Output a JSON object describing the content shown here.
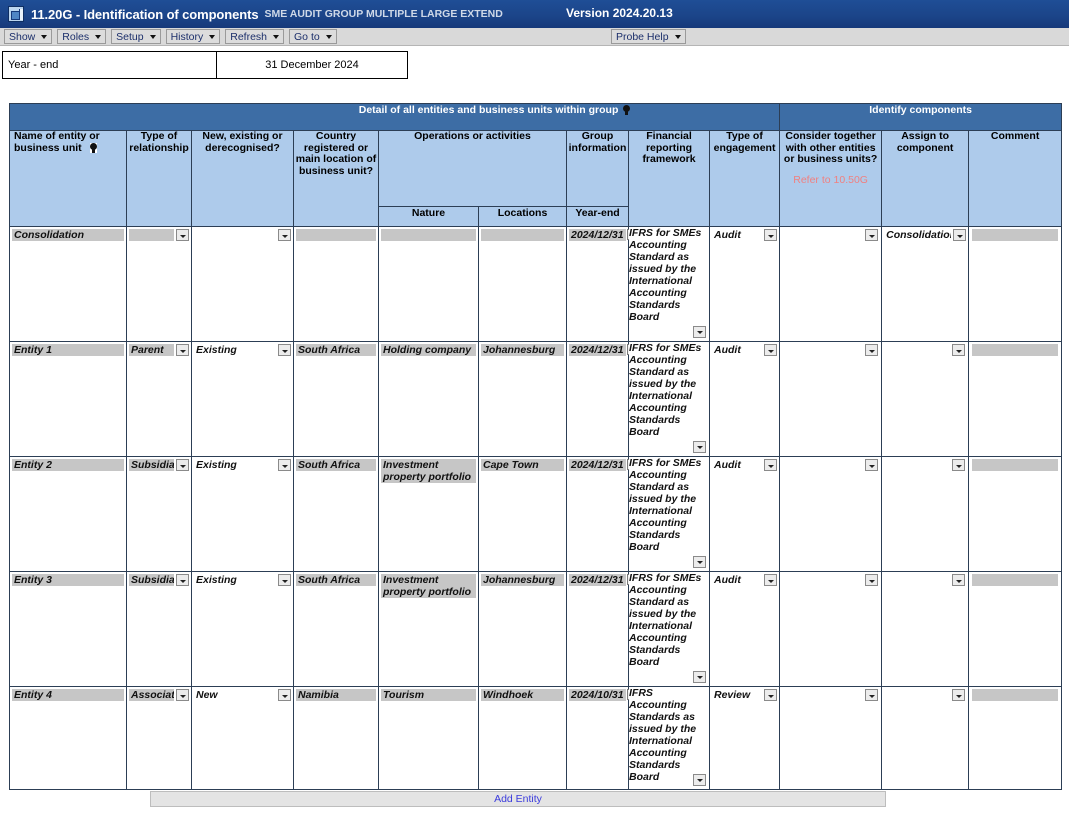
{
  "titlebar": {
    "icon": "app-window-icon",
    "title": "11.20G - Identification of components",
    "subtitle": "SME  AUDIT  GROUP MULTIPLE  LARGE  EXTEND",
    "version": "Version 2024.20.13"
  },
  "menubar": {
    "items": [
      {
        "label": "Show"
      },
      {
        "label": "Roles"
      },
      {
        "label": "Setup"
      },
      {
        "label": "History"
      },
      {
        "label": "Refresh"
      },
      {
        "label": "Go to"
      }
    ],
    "probe_help": "Probe Help"
  },
  "infostrip": {
    "label": "Year - end",
    "value": "31 December 2024"
  },
  "grid": {
    "bands": {
      "detail": "Detail of all entities and business units within group",
      "identify": "Identify components"
    },
    "headers": {
      "name": "Name of entity or business unit",
      "type_of_relationship": "Type of relationship",
      "new_existing": "New, existing or derecognised?",
      "country": "Country registered or main location of business unit?",
      "operations": "Operations or activities",
      "nature": "Nature",
      "locations": "Locations",
      "group_information": "Group information",
      "year_end": "Year-end",
      "framework": "Financial reporting framework",
      "engagement": "Type of engagement",
      "consider_together": "Consider together with other entities or business units?",
      "consider_together_refer": "Refer to 10.50G",
      "assign": "Assign to component",
      "comment": "Comment"
    },
    "frameworks": {
      "sme": "IFRS for SMEs Accounting Standard as issued by the International Accounting Standards Board",
      "full": "IFRS Accounting Standards as issued by the International Accounting Standards Board"
    },
    "rows": [
      {
        "name": "Consolidation",
        "type_of_relationship": "",
        "new_existing": "",
        "country": "",
        "nature": "",
        "locations": "",
        "year_end": "2024/12/31",
        "framework": "IFRS for SMEs Accounting Standard as issued by the International Accounting Standards Board",
        "engagement": "Audit",
        "consider_together": "",
        "assign": "Consolidation",
        "comment": ""
      },
      {
        "name": "Entity 1",
        "type_of_relationship": "Parent",
        "new_existing": "Existing",
        "country": "South Africa",
        "nature": "Holding company",
        "locations": "Johannesburg",
        "year_end": "2024/12/31",
        "framework": "IFRS for SMEs Accounting Standard as issued by the International Accounting Standards Board",
        "engagement": "Audit",
        "consider_together": "",
        "assign": "",
        "comment": ""
      },
      {
        "name": "Entity 2",
        "type_of_relationship": "Subsidiary",
        "new_existing": "Existing",
        "country": "South Africa",
        "nature": "Investment property portfolio",
        "locations": "Cape Town",
        "year_end": "2024/12/31",
        "framework": "IFRS for SMEs Accounting Standard as issued by the International Accounting Standards Board",
        "engagement": "Audit",
        "consider_together": "",
        "assign": "",
        "comment": ""
      },
      {
        "name": "Entity 3",
        "type_of_relationship": "Subsidiary",
        "new_existing": "Existing",
        "country": "South Africa",
        "nature": "Investment property portfolio",
        "locations": "Johannesburg",
        "year_end": "2024/12/31",
        "framework": "IFRS for SMEs Accounting Standard as issued by the International Accounting Standards Board",
        "engagement": "Audit",
        "consider_together": "",
        "assign": "",
        "comment": ""
      },
      {
        "name": "Entity 4",
        "type_of_relationship": "Associate",
        "new_existing": "New",
        "country": "Namibia",
        "nature": "Tourism",
        "locations": "Windhoek",
        "year_end": "2024/10/31",
        "framework": "IFRS Accounting Standards as issued by the International Accounting Standards Board",
        "engagement": "Review",
        "consider_together": "",
        "assign": "",
        "comment": ""
      }
    ]
  },
  "add_entity": "Add Entity",
  "colors": {
    "titlebar": "#1b4488",
    "band": "#3d6da5",
    "colhead": "#aecbeb",
    "field": "#c6c6c6",
    "refer_link": "#f08080",
    "add_entity_link": "#3b3bdd",
    "menu_text": "#1c2f6b"
  }
}
